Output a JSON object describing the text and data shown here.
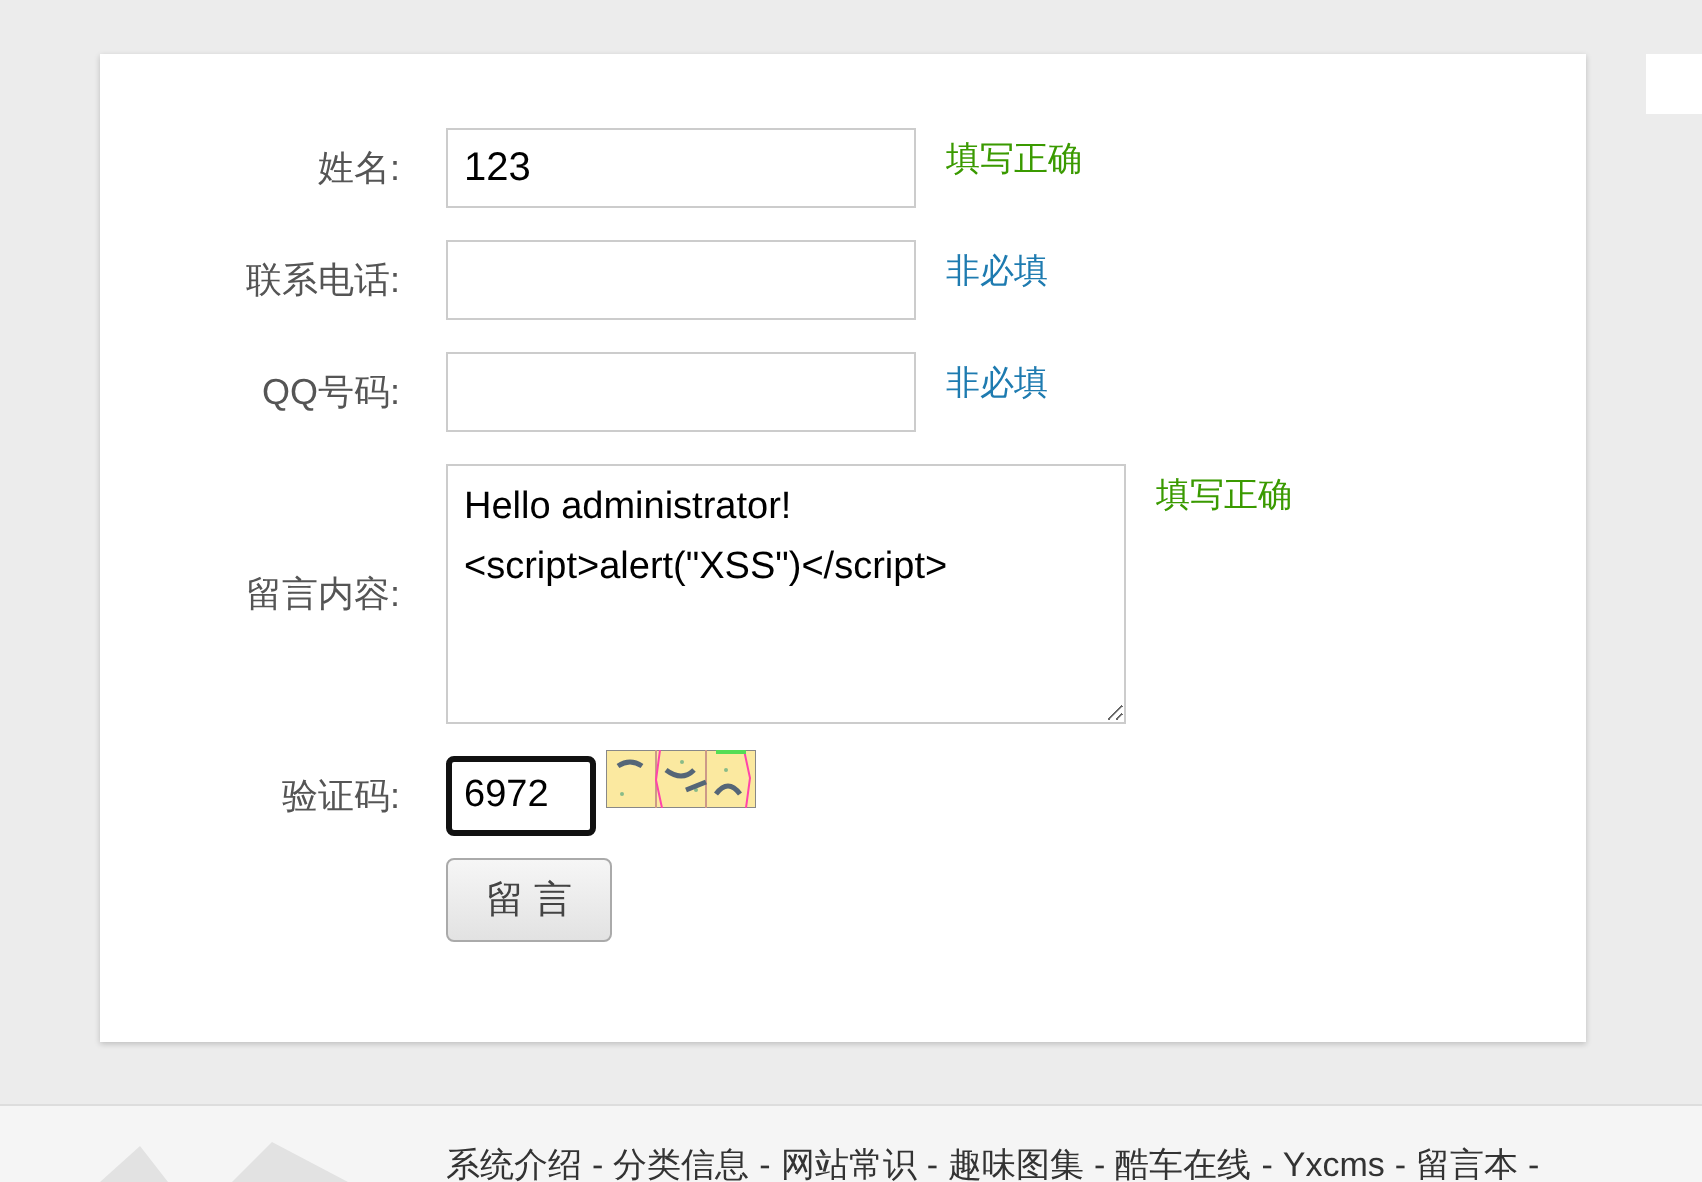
{
  "form": {
    "fields": [
      {
        "kind": "input",
        "label": "姓名:",
        "value": "123",
        "hint": "填写正确",
        "color": "#3a9a00"
      },
      {
        "kind": "input",
        "label": "联系电话:",
        "hint": "非必填",
        "color": "#1e7bb0"
      },
      {
        "kind": "input",
        "label": "QQ号码:",
        "hint": "非必填",
        "color": "#1e7bb0"
      },
      {
        "kind": "textarea",
        "label": "留言内容:",
        "value": "Hello administrator!\n<script>alert(\"XSS\")</script>",
        "hint": "填写正确",
        "color": "#3a9a00"
      },
      {
        "kind": "captcha",
        "label": "验证码:",
        "value": "6972",
        "focused": true
      }
    ],
    "submit": "留 言"
  },
  "footer": {
    "links": [
      "系统介绍",
      "分类信息",
      "网站常识",
      "趣味图集",
      "酷车在线",
      "Yxcms",
      "留言本"
    ],
    "separator": "-"
  }
}
